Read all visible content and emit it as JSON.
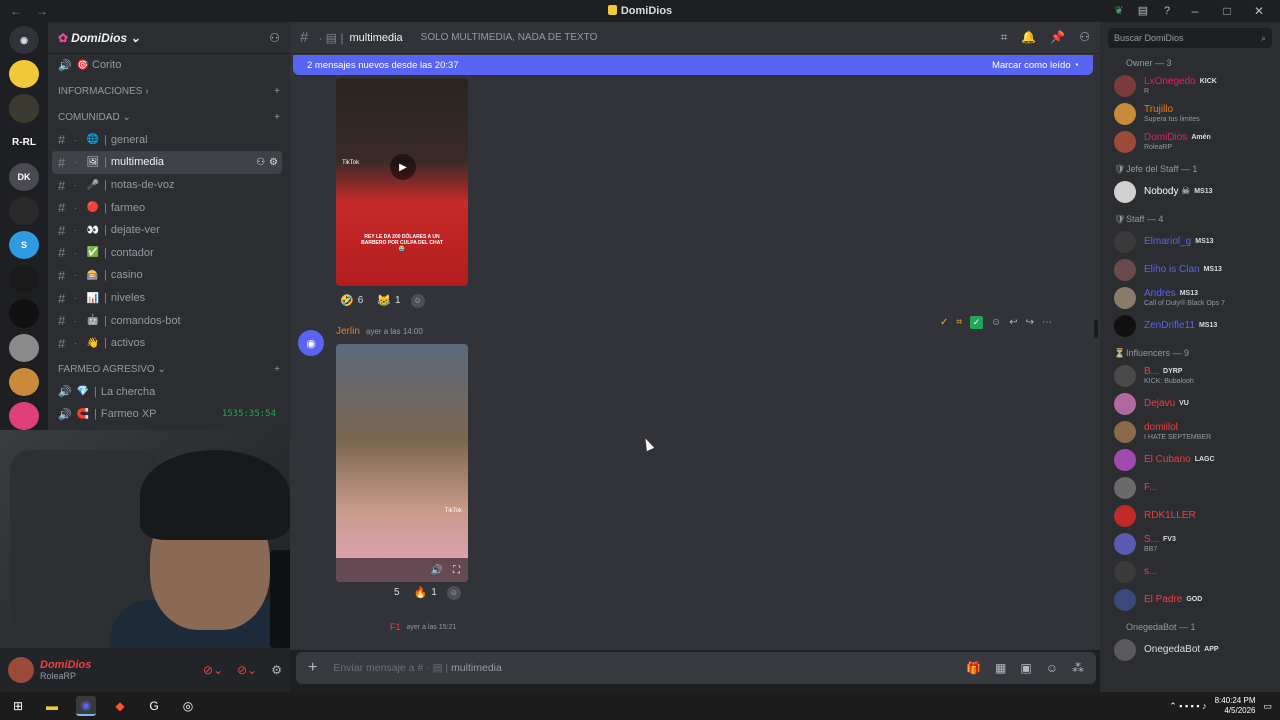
{
  "window": {
    "title": "DomiDios"
  },
  "rail": {
    "servers": [
      {
        "label": ""
      },
      {
        "label": ""
      },
      {
        "label": ""
      },
      {
        "label": "R-RL"
      },
      {
        "label": "DK"
      },
      {
        "label": ""
      },
      {
        "label": "S"
      },
      {
        "label": ""
      },
      {
        "label": ""
      },
      {
        "label": ""
      },
      {
        "label": ""
      },
      {
        "label": ""
      }
    ]
  },
  "server": {
    "name": "DomiDios",
    "channels_top": [
      {
        "emoji": "🎯",
        "name": "Corito"
      }
    ],
    "categories": {
      "info": "INFORMACIONES",
      "comunidad": "COMUNIDAD",
      "farmeo": "FARMEO AGRESIVO"
    },
    "text_channels": [
      {
        "emoji": "🌐",
        "name": "general"
      },
      {
        "emoji": "🖼",
        "name": "multimedia"
      },
      {
        "emoji": "🎤",
        "name": "notas-de-voz"
      },
      {
        "emoji": "🔴",
        "name": "farmeo"
      },
      {
        "emoji": "👀",
        "name": "dejate-ver"
      },
      {
        "emoji": "✅",
        "name": "contador"
      },
      {
        "emoji": "🎰",
        "name": "casino"
      },
      {
        "emoji": "📊",
        "name": "niveles"
      },
      {
        "emoji": "🤖",
        "name": "comandos-bot"
      },
      {
        "emoji": "👋",
        "name": "activos"
      }
    ],
    "voice_channels": [
      {
        "emoji": "💎",
        "name": "La chercha",
        "timer": ""
      },
      {
        "emoji": "🧲",
        "name": "Farmeo XP",
        "timer": "1535:35:54"
      }
    ]
  },
  "user_panel": {
    "name": "DomiDios",
    "status": "RoleaRP"
  },
  "channel": {
    "name": "multimedia",
    "topic": "SOLO MULTIMEDIA, NADA DE TEXTO"
  },
  "banner": {
    "text": "2 mensajes nuevos desde las 20:37",
    "action": "Marcar como leído"
  },
  "messages": [
    {
      "media_caption": "REY LE DA 200 DÓLARES A UN BARBERO POR CULPA DEL CHAT 😭",
      "media_label": "TikTok",
      "reactions": [
        {
          "emoji": "🤣",
          "count": "6"
        },
        {
          "emoji": "😹",
          "count": "1"
        }
      ]
    },
    {
      "author": "Jerlin",
      "timestamp": "ayer a las 14:00",
      "media_label": "TikTok",
      "reactions": [
        {
          "emoji": "😂",
          "count": "5"
        },
        {
          "emoji": "🔥",
          "count": "1"
        }
      ]
    },
    {
      "author": "F1",
      "timestamp": "ayer a las 15:21"
    }
  ],
  "composer": {
    "placeholder_prefix": "Enviar mensaje a #",
    "channel": "multimedia"
  },
  "members": {
    "search_placeholder": "Buscar DomiDios",
    "groups": [
      {
        "title": "Owner — 3",
        "icon": "",
        "members": [
          {
            "name": "LxOnegedo",
            "tag": "KICK",
            "sub": "R",
            "color": "#e91e63",
            "avatar": "#7a3b3b"
          },
          {
            "name": "Trujillo",
            "tag": "",
            "sub": "Supera tus limites",
            "color": "#e67e22",
            "avatar": "#c98a3a"
          },
          {
            "name": "DomiDios",
            "tag": "Amén",
            "sub": "RoleaRP",
            "color": "#e91e63",
            "avatar": "#9c4a3a"
          }
        ]
      },
      {
        "title": "Jefe del Staff — 1",
        "icon": "🛡",
        "members": [
          {
            "name": "Nobody ☠",
            "tag": "MS13",
            "sub": "",
            "color": "#ffffff",
            "avatar": "#d0d0d0"
          }
        ]
      },
      {
        "title": "Staff — 4",
        "icon": "🛡",
        "members": [
          {
            "name": "Elmariol_g",
            "tag": "MS13",
            "sub": "",
            "color": "#5865f2",
            "avatar": "#3a3a3a"
          },
          {
            "name": "Eliho is Clan",
            "tag": "MS13",
            "sub": "",
            "color": "#5865f2",
            "avatar": "#6a4a4a"
          },
          {
            "name": "Andres",
            "tag": "MS13",
            "sub": "Call of Duty® Black Ops 7",
            "color": "#5865f2",
            "avatar": "#8a7a6a"
          },
          {
            "name": "ZenDrifle11",
            "tag": "MS13",
            "sub": "",
            "color": "#5865f2",
            "avatar": "#111111"
          }
        ]
      },
      {
        "title": "Influencers — 9",
        "icon": "⏳",
        "members": [
          {
            "name": "B...",
            "tag": "DYRP",
            "sub": "KICK: Bubalooh",
            "color": "#f23f43",
            "avatar": "#4a4a4a"
          },
          {
            "name": "Dejavu",
            "tag": "VU",
            "sub": "",
            "color": "#f23f43",
            "avatar": "#b06aa0"
          },
          {
            "name": "domiilol",
            "tag": "",
            "sub": "I HATE SEPTEMBER",
            "color": "#f23f43",
            "avatar": "#8a6a4a"
          },
          {
            "name": "El Cubano",
            "tag": "LAGC",
            "sub": "",
            "color": "#f23f43",
            "avatar": "#a04ab0"
          },
          {
            "name": "F...",
            "tag": "",
            "sub": "",
            "color": "#f23f43",
            "avatar": "#6a6a6a"
          },
          {
            "name": "RDK1LLER",
            "tag": "",
            "sub": "",
            "color": "#f23f43",
            "avatar": "#c02a2a"
          },
          {
            "name": "S...",
            "tag": "FV3",
            "sub": "BB7",
            "color": "#f23f43",
            "avatar": "#5a5ab0"
          },
          {
            "name": "s...",
            "tag": "",
            "sub": "",
            "color": "#f23f43",
            "avatar": "#3a3a3a"
          },
          {
            "name": "El Padre",
            "tag": "GOD",
            "sub": "",
            "color": "#f23f43",
            "avatar": "#3a4a7a"
          }
        ]
      },
      {
        "title": "OnegedaBot — 1",
        "icon": "",
        "members": [
          {
            "name": "OnegedaBot",
            "tag": "APP",
            "sub": "",
            "color": "#dbdee1",
            "avatar": "#5a5a5a"
          }
        ]
      }
    ]
  },
  "taskbar": {
    "time": "8:40:24 PM",
    "date": "4/5/2026"
  }
}
